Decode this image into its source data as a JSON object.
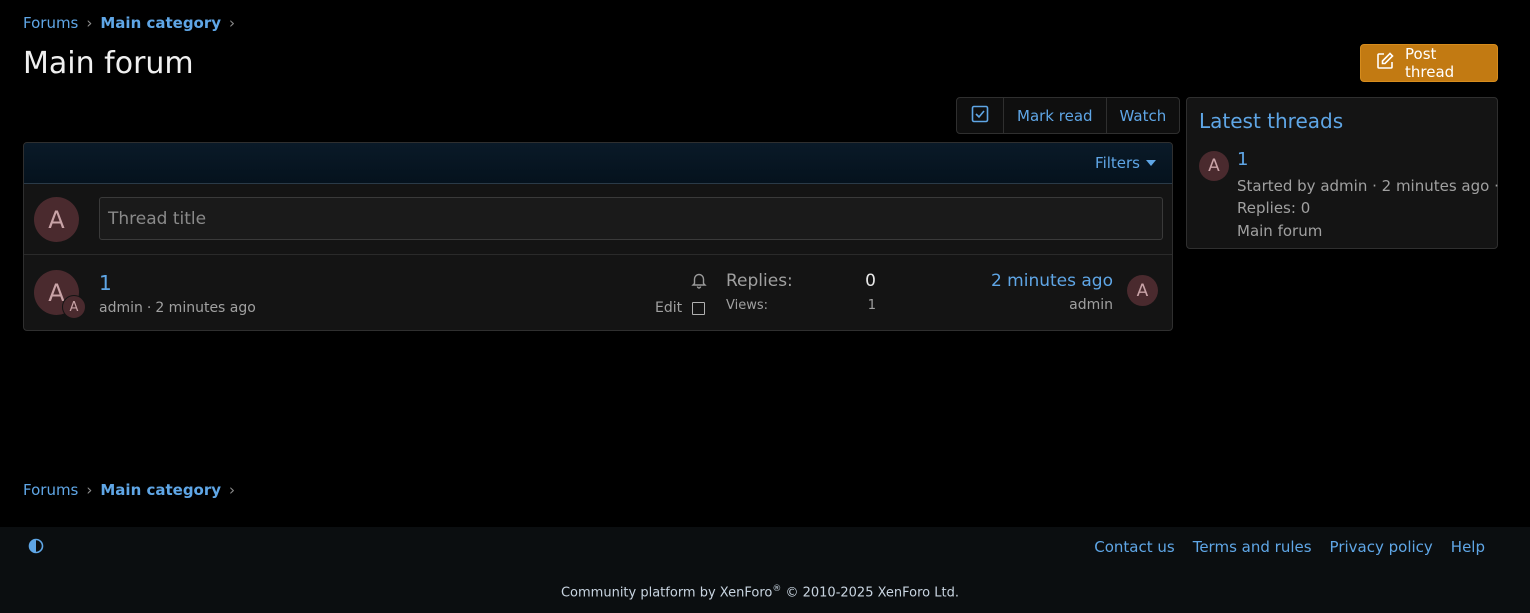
{
  "breadcrumb": {
    "items": [
      "Forums",
      "Main category"
    ],
    "separator": "›"
  },
  "header": {
    "title": "Main forum",
    "post_thread_label": "Post thread"
  },
  "toolbar": {
    "mark_read_label": "Mark read",
    "watch_label": "Watch"
  },
  "thread_list": {
    "filters_label": "Filters",
    "quick_thread": {
      "avatar_letter": "A",
      "placeholder": "Thread title"
    },
    "threads": [
      {
        "title": "1",
        "author": "admin",
        "meta_sep": "·",
        "started": "2 minutes ago",
        "avatar_letter": "A",
        "mini_avatar_letter": "A",
        "edit_label": "Edit",
        "replies_label": "Replies:",
        "replies": "0",
        "views_label": "Views:",
        "views": "1",
        "last_post_time": "2 minutes ago",
        "last_poster": "admin",
        "last_avatar_letter": "A"
      }
    ]
  },
  "sidebar": {
    "title": "Latest threads",
    "items": [
      {
        "avatar_letter": "A",
        "title": "1",
        "meta_line": "Started by admin · 2 minutes ago ·",
        "replies": "Replies: 0",
        "forum": "Main forum"
      }
    ]
  },
  "footer": {
    "links": [
      "Contact us",
      "Terms and rules",
      "Privacy policy",
      "Help"
    ],
    "copyright_prefix": "Community platform by XenForo",
    "registered_mark": "®",
    "copyright_suffix": " © 2010-2025 XenForo Ltd."
  },
  "colors": {
    "link": "#5fa6e6",
    "accent_button": "#c27a12",
    "background": "#000000",
    "avatar_bg": "#4a2a2e"
  },
  "icons": {
    "post_thread": "pencil-square-icon",
    "select_toggle": "checkbox-checked-icon",
    "watch_bell": "bell-icon",
    "theme_toggle": "contrast-icon"
  }
}
